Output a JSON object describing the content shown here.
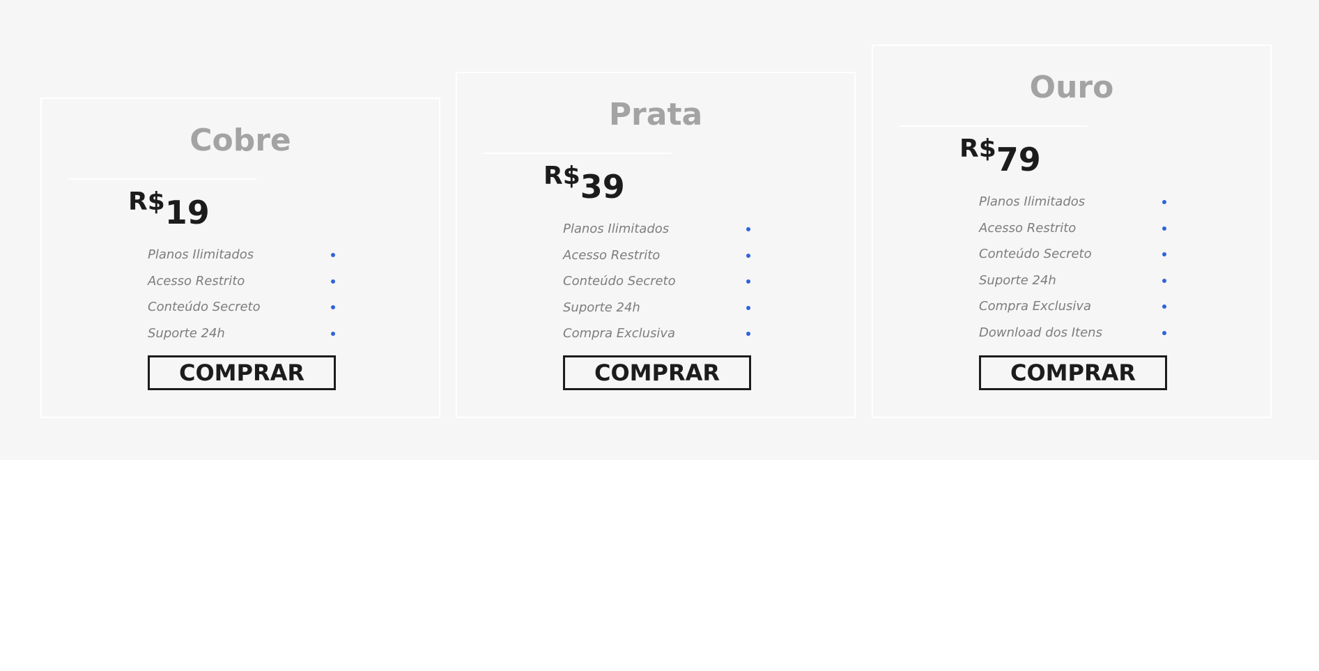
{
  "plans": [
    {
      "name": "Cobre",
      "currency": "R$",
      "price": "19",
      "features": [
        "Planos Ilimitados",
        "Acesso Restrito",
        "Conteúdo Secreto",
        "Suporte 24h"
      ],
      "button_label": "COMPRAR"
    },
    {
      "name": "Prata",
      "currency": "R$",
      "price": "39",
      "features": [
        "Planos Ilimitados",
        "Acesso Restrito",
        "Conteúdo Secreto",
        "Suporte 24h",
        "Compra Exclusiva"
      ],
      "button_label": "COMPRAR"
    },
    {
      "name": "Ouro",
      "currency": "R$",
      "price": "79",
      "features": [
        "Planos Ilimitados",
        "Acesso Restrito",
        "Conteúdo Secreto",
        "Suporte 24h",
        "Compra Exclusiva",
        "Download dos Itens"
      ],
      "button_label": "COMPRAR"
    }
  ],
  "colors": {
    "section_bg": "#f6f6f6",
    "plan_name": "#a3a3a3",
    "price": "#1c1c1c",
    "feature_text": "#7d7d7d",
    "bullet": "#2f63d8",
    "button_border": "#1c1c1c"
  }
}
